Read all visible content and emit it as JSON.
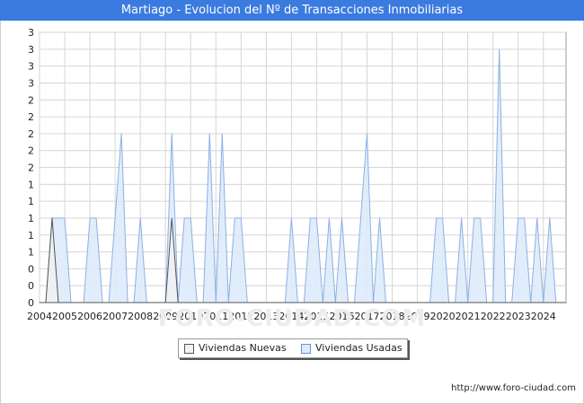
{
  "title": "Martiago - Evolucion del Nº de Transacciones Inmobiliarias",
  "watermark": "FORO-CIUDAD.COM",
  "footer": "http://www.foro-ciudad.com",
  "colors": {
    "title_bar": "#3b7be0",
    "nuevas_fill": "#f2f2f2",
    "nuevas_line": "#555555",
    "usadas_fill": "#deebfb",
    "usadas_line": "#8cb0e4"
  },
  "legend": {
    "nuevas": "Viviendas Nuevas",
    "usadas": "Viviendas Usadas"
  },
  "chart_data": {
    "type": "area",
    "title": "Martiago - Evolucion del Nº de Transacciones Inmobiliarias",
    "xlabel": "",
    "ylabel": "",
    "grid": true,
    "legend_position": "bottom",
    "xlim": [
      2004.0,
      2024.9
    ],
    "ylim": [
      0,
      3.2
    ],
    "x_ticks": [
      "2004",
      "2005",
      "2006",
      "2007",
      "2008",
      "2009",
      "2010",
      "2011",
      "2012",
      "2013",
      "2014",
      "2015",
      "2016",
      "2017",
      "2018",
      "2019",
      "2020",
      "2021",
      "2022",
      "2023",
      "2024"
    ],
    "y_ticks": [
      {
        "value": 0.0,
        "label": "0"
      },
      {
        "value": 0.2,
        "label": "0"
      },
      {
        "value": 0.4,
        "label": "0"
      },
      {
        "value": 0.6,
        "label": "1"
      },
      {
        "value": 0.8,
        "label": "1"
      },
      {
        "value": 1.0,
        "label": "1"
      },
      {
        "value": 1.2,
        "label": "1"
      },
      {
        "value": 1.4,
        "label": "1"
      },
      {
        "value": 1.6,
        "label": "2"
      },
      {
        "value": 1.8,
        "label": "2"
      },
      {
        "value": 2.0,
        "label": "2"
      },
      {
        "value": 2.2,
        "label": "2"
      },
      {
        "value": 2.4,
        "label": "2"
      },
      {
        "value": 2.6,
        "label": "3"
      },
      {
        "value": 2.8,
        "label": "3"
      },
      {
        "value": 3.0,
        "label": "3"
      },
      {
        "value": 3.2,
        "label": "3"
      }
    ],
    "series": [
      {
        "name": "Viviendas Nuevas",
        "points": [
          [
            2004.0,
            0
          ],
          [
            2004.25,
            0
          ],
          [
            2004.5,
            1
          ],
          [
            2004.75,
            0
          ],
          [
            2005.0,
            0
          ],
          [
            2009.0,
            0
          ],
          [
            2009.25,
            1
          ],
          [
            2009.5,
            0
          ],
          [
            2024.9,
            0
          ]
        ]
      },
      {
        "name": "Viviendas Usadas",
        "points": [
          [
            2004.0,
            0
          ],
          [
            2004.25,
            0
          ],
          [
            2004.5,
            1
          ],
          [
            2004.75,
            1
          ],
          [
            2005.0,
            1
          ],
          [
            2005.25,
            0
          ],
          [
            2005.5,
            0
          ],
          [
            2005.75,
            0
          ],
          [
            2006.0,
            1
          ],
          [
            2006.25,
            1
          ],
          [
            2006.5,
            0
          ],
          [
            2006.75,
            0
          ],
          [
            2007.0,
            1
          ],
          [
            2007.25,
            2
          ],
          [
            2007.5,
            0
          ],
          [
            2007.75,
            0
          ],
          [
            2008.0,
            1
          ],
          [
            2008.25,
            0
          ],
          [
            2009.0,
            0
          ],
          [
            2009.25,
            2
          ],
          [
            2009.5,
            0
          ],
          [
            2009.75,
            1
          ],
          [
            2010.0,
            1
          ],
          [
            2010.25,
            0
          ],
          [
            2010.5,
            0
          ],
          [
            2010.75,
            2
          ],
          [
            2011.0,
            0
          ],
          [
            2011.25,
            2
          ],
          [
            2011.5,
            0
          ],
          [
            2011.75,
            1
          ],
          [
            2012.0,
            1
          ],
          [
            2012.25,
            0
          ],
          [
            2013.75,
            0
          ],
          [
            2014.0,
            1
          ],
          [
            2014.25,
            0
          ],
          [
            2014.5,
            0
          ],
          [
            2014.75,
            1
          ],
          [
            2015.0,
            1
          ],
          [
            2015.25,
            0
          ],
          [
            2015.5,
            1
          ],
          [
            2015.75,
            0
          ],
          [
            2016.0,
            1
          ],
          [
            2016.25,
            0
          ],
          [
            2016.5,
            0
          ],
          [
            2016.75,
            1
          ],
          [
            2017.0,
            2
          ],
          [
            2017.25,
            0
          ],
          [
            2017.5,
            1
          ],
          [
            2017.75,
            0
          ],
          [
            2019.5,
            0
          ],
          [
            2019.75,
            1
          ],
          [
            2020.0,
            1
          ],
          [
            2020.25,
            0
          ],
          [
            2020.5,
            0
          ],
          [
            2020.75,
            1
          ],
          [
            2021.0,
            0
          ],
          [
            2021.25,
            1
          ],
          [
            2021.5,
            1
          ],
          [
            2021.75,
            0
          ],
          [
            2022.0,
            0
          ],
          [
            2022.25,
            3
          ],
          [
            2022.5,
            0
          ],
          [
            2022.75,
            0
          ],
          [
            2023.0,
            1
          ],
          [
            2023.25,
            1
          ],
          [
            2023.5,
            0
          ],
          [
            2023.75,
            1
          ],
          [
            2024.0,
            0
          ],
          [
            2024.25,
            1
          ],
          [
            2024.5,
            0
          ],
          [
            2024.9,
            0
          ]
        ]
      }
    ]
  }
}
